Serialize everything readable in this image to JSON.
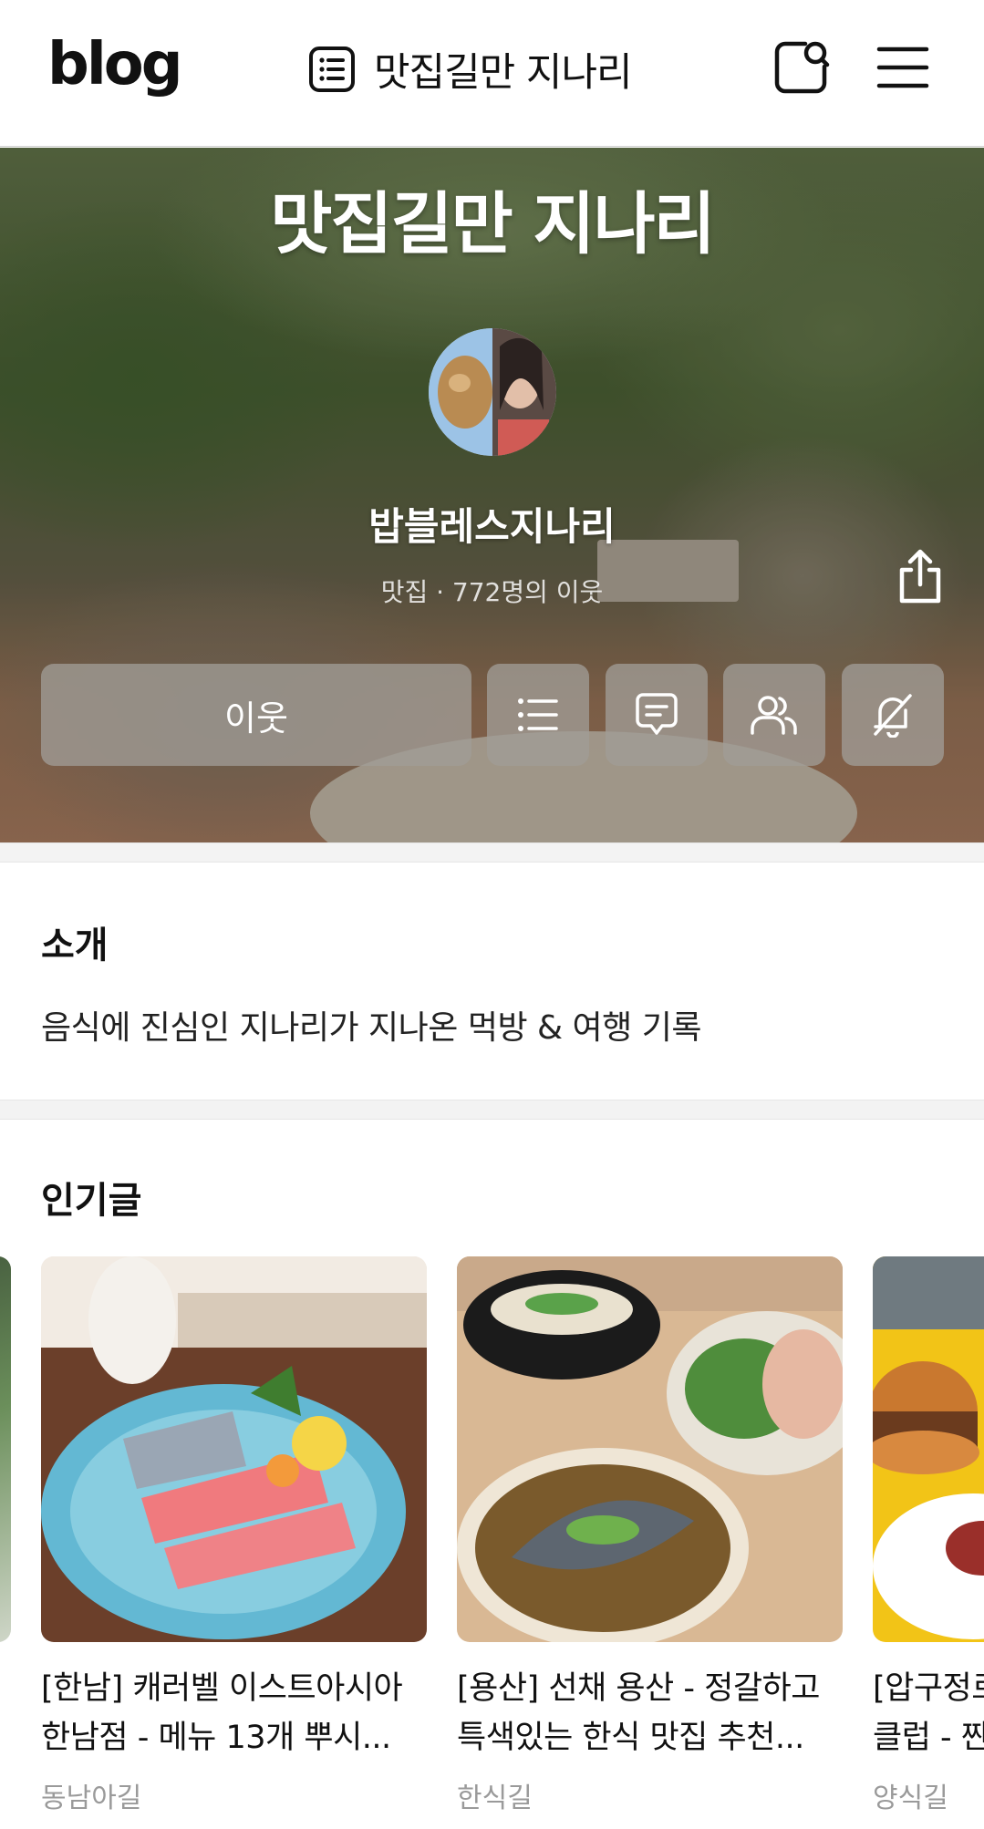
{
  "header": {
    "logo": "blog",
    "blog_title": "맛집길만 지나리"
  },
  "hero": {
    "title": "맛집길만 지나리",
    "blog_name": "밥블레스지나리",
    "meta": "맛집 · 772명의 이웃",
    "neighbor_button": "이웃"
  },
  "intro": {
    "heading": "소개",
    "text": "음식에 진심인 지나리가 지나온 먹방 & 여행 기록"
  },
  "popular": {
    "heading": "인기글",
    "cards": [
      {
        "title_line1": "[한남] 캐러벨 이스트아시아",
        "title_line2": "한남점 - 메뉴 13개 뿌시...",
        "category": "동남아길"
      },
      {
        "title_line1": "[용산] 선채 용산 - 정갈하고",
        "title_line2": "특색있는 한식 맛집 추천...",
        "category": "한식길"
      },
      {
        "title_line1": "[압구정로",
        "title_line2": "클럽 - 짠",
        "category": "양식길"
      }
    ]
  },
  "icons": {
    "header_list": "list-doc-icon",
    "header_search": "search-square-icon",
    "header_menu": "hamburger-menu-icon",
    "share": "share-icon",
    "category_list": "list-icon",
    "guestbook": "comment-icon",
    "neighbors": "people-icon",
    "mute": "notification-off-icon"
  }
}
